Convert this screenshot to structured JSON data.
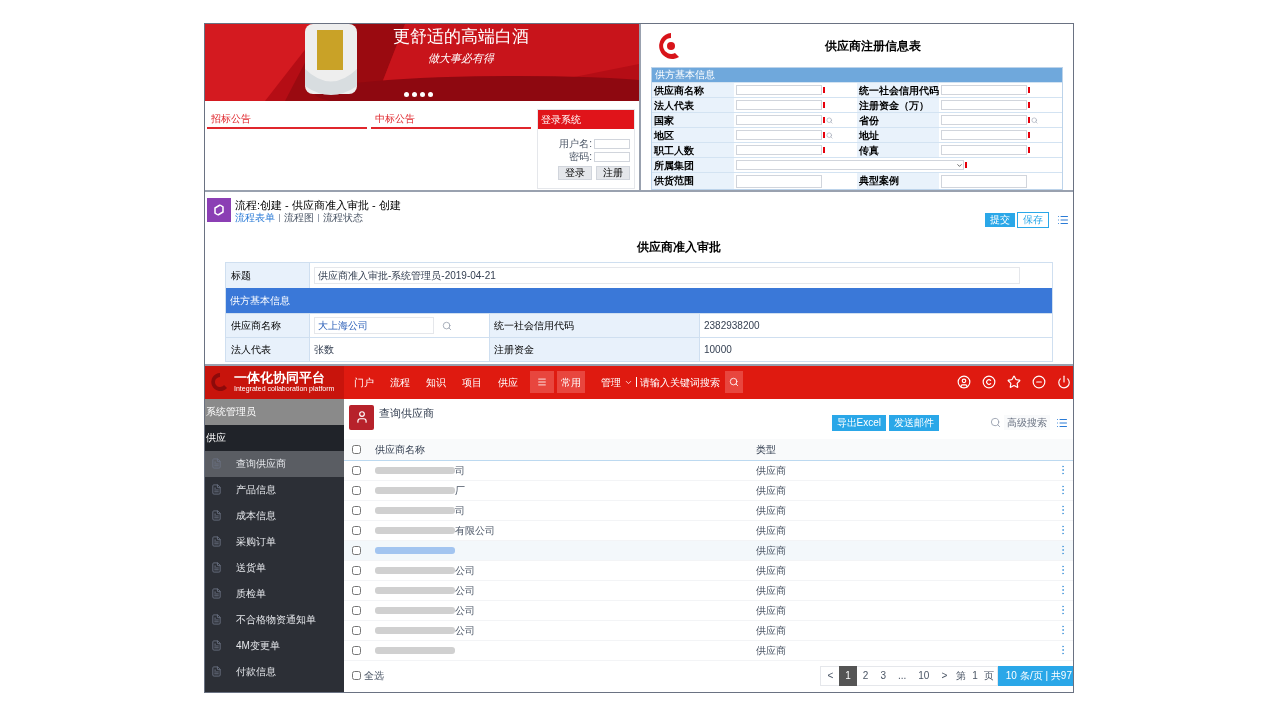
{
  "portal": {
    "headline": "更舒适的高端白酒",
    "slogan": "做大事必有得",
    "notices": [
      {
        "title": "招标公告"
      },
      {
        "title": "中标公告"
      }
    ],
    "login": {
      "title": "登录系统",
      "fields": [
        {
          "label": "用户名:"
        },
        {
          "label": "密码:"
        }
      ],
      "buttons": [
        "登录",
        "注册"
      ]
    }
  },
  "registration_form": {
    "title": "供应商注册信息表",
    "section": "供方基本信息",
    "rows": [
      {
        "kind": "pair",
        "fields": [
          {
            "label": "供应商名称",
            "required": true,
            "lookup": false
          },
          {
            "label": "统一社会信用代码",
            "required": true,
            "lookup": false
          }
        ]
      },
      {
        "kind": "pair",
        "fields": [
          {
            "label": "法人代表",
            "required": true,
            "lookup": false
          },
          {
            "label": "注册资金（万）",
            "required": true,
            "lookup": false
          }
        ]
      },
      {
        "kind": "pair",
        "fields": [
          {
            "label": "国家",
            "required": true,
            "lookup": true
          },
          {
            "label": "省份",
            "required": true,
            "lookup": true
          }
        ]
      },
      {
        "kind": "pair",
        "fields": [
          {
            "label": "地区",
            "required": true,
            "lookup": true
          },
          {
            "label": "地址",
            "required": true,
            "lookup": false
          }
        ]
      },
      {
        "kind": "pair",
        "fields": [
          {
            "label": "职工人数",
            "required": true,
            "lookup": false
          },
          {
            "label": "传真",
            "required": true,
            "lookup": false
          }
        ]
      },
      {
        "kind": "select",
        "fields": [
          {
            "label": "所属集团",
            "required": true,
            "lookup": false
          }
        ]
      },
      {
        "kind": "textarea",
        "fields": [
          {
            "label": "供货范围",
            "required": false,
            "lookup": false
          },
          {
            "label": "典型案例",
            "required": false,
            "lookup": false
          }
        ]
      }
    ]
  },
  "workflow": {
    "title": "流程:创建 - 供应商准入审批 - 创建",
    "tabs": [
      {
        "label": "流程表单",
        "selected": true
      },
      {
        "label": "流程图",
        "selected": false
      },
      {
        "label": "流程状态",
        "selected": false
      }
    ],
    "buttons": [
      {
        "label": "提交",
        "primary": true
      },
      {
        "label": "保存",
        "primary": false
      }
    ],
    "form_title": "供应商准入审批",
    "title_row": {
      "label": "标题",
      "value": "供应商准入审批-系统管理员-2019-04-21"
    },
    "section": "供方基本信息",
    "rows": [
      {
        "label": "供应商名称",
        "value": "大上海公司",
        "link": true,
        "label_2": "统一社会信用代码",
        "value_2": "2382938200"
      },
      {
        "label": "法人代表",
        "value": "张数",
        "link": false,
        "label_2": "注册资金",
        "value_2": "10000"
      }
    ]
  },
  "platform": {
    "logo": "一体化协同平台",
    "logo_subtitle": "Integrated collaboration platform",
    "nav": [
      {
        "label": "门户"
      },
      {
        "label": "流程"
      },
      {
        "label": "知识"
      },
      {
        "label": "项目"
      },
      {
        "label": "供应"
      }
    ],
    "common": "常用",
    "search_scope": "管理",
    "search_placeholder": "请输入关键词搜索",
    "user": "系统管理员",
    "module": "供应",
    "sidebar": [
      {
        "label": "查询供应商",
        "selected": true
      },
      {
        "label": "产品信息",
        "selected": false
      },
      {
        "label": "成本信息",
        "selected": false
      },
      {
        "label": "采购订单",
        "selected": false
      },
      {
        "label": "送货单",
        "selected": false
      },
      {
        "label": "质检单",
        "selected": false
      },
      {
        "label": "不合格物资通知单",
        "selected": false
      },
      {
        "label": "4M变更单",
        "selected": false
      },
      {
        "label": "付款信息",
        "selected": false
      }
    ],
    "page_title": "查询供应商",
    "actions": [
      "导出Excel",
      "发送邮件"
    ],
    "advanced_search": "高级搜索",
    "header_checked": false,
    "select_all_checked": false,
    "columns": [
      "供应商名称",
      "类型"
    ],
    "rows": [
      {
        "name_visible": "司",
        "type": "供应商",
        "highlighted": false,
        "checked": false
      },
      {
        "name_visible": "厂",
        "type": "供应商",
        "highlighted": false,
        "checked": false
      },
      {
        "name_visible": "司",
        "type": "供应商",
        "highlighted": false,
        "checked": false
      },
      {
        "name_visible": "有限公司",
        "type": "供应商",
        "highlighted": false,
        "checked": false
      },
      {
        "type": "供应商",
        "highlighted": true,
        "checked": false
      },
      {
        "name_visible": "公司",
        "type": "供应商",
        "highlighted": false,
        "checked": false
      },
      {
        "name_visible": "公司",
        "type": "供应商",
        "highlighted": false,
        "checked": false
      },
      {
        "name_visible": "公司",
        "type": "供应商",
        "highlighted": false,
        "checked": false
      },
      {
        "name_visible": "公司",
        "type": "供应商",
        "highlighted": false,
        "checked": false
      },
      {
        "type": "供应商",
        "highlighted": false,
        "checked": false
      }
    ],
    "select_all": "全选",
    "pagination": [
      {
        "label": "<",
        "selected": false
      },
      {
        "label": "1",
        "selected": true
      },
      {
        "label": "2",
        "selected": false
      },
      {
        "label": "3",
        "selected": false
      },
      {
        "label": "...",
        "selected": false
      },
      {
        "label": "10",
        "selected": false
      },
      {
        "label": ">",
        "selected": false
      }
    ],
    "page_jump": [
      "第",
      "1",
      "页"
    ],
    "page_size": "10",
    "page_info": "条/页 | 共97"
  }
}
